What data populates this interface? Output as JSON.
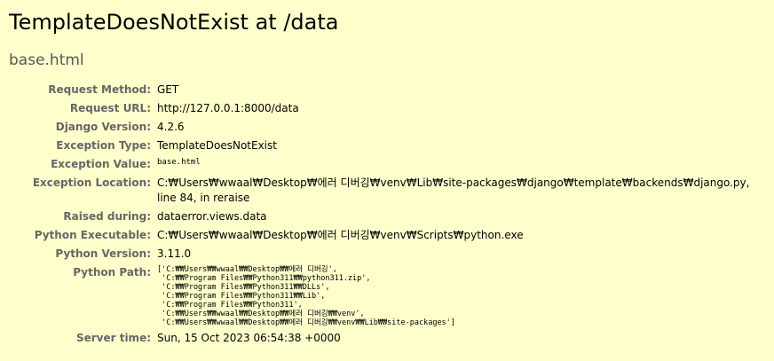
{
  "title": "TemplateDoesNotExist at /data",
  "subtitle": "base.html",
  "meta": {
    "request_method": {
      "label": "Request Method:",
      "value": "GET"
    },
    "request_url": {
      "label": "Request URL:",
      "value": "http://127.0.0.1:8000/data"
    },
    "django_version": {
      "label": "Django Version:",
      "value": "4.2.6"
    },
    "exception_type": {
      "label": "Exception Type:",
      "value": "TemplateDoesNotExist"
    },
    "exception_value": {
      "label": "Exception Value:",
      "value": "base.html"
    },
    "exception_location": {
      "label": "Exception Location:",
      "value": "C:₩Users₩wwaal₩Desktop₩에러 디버깅₩venv₩Lib₩site-packages₩django₩template₩backends₩django.py, line 84, in reraise"
    },
    "raised_during": {
      "label": "Raised during:",
      "value": "dataerror.views.data"
    },
    "python_executable": {
      "label": "Python Executable:",
      "value": "C:₩Users₩wwaal₩Desktop₩에러 디버깅₩venv₩Scripts₩python.exe"
    },
    "python_version": {
      "label": "Python Version:",
      "value": "3.11.0"
    },
    "python_path": {
      "label": "Python Path:",
      "value": "['C:₩₩Users₩₩wwaal₩₩Desktop₩₩에러 디버깅',\n 'C:₩₩Program Files₩₩Python311₩₩python311.zip',\n 'C:₩₩Program Files₩₩Python311₩₩DLLs',\n 'C:₩₩Program Files₩₩Python311₩₩Lib',\n 'C:₩₩Program Files₩₩Python311',\n 'C:₩₩Users₩₩wwaal₩₩Desktop₩₩에러 디버깅₩₩venv',\n 'C:₩₩Users₩₩wwaal₩₩Desktop₩₩에러 디버깅₩₩venv₩₩Lib₩₩site-packages']"
    },
    "server_time": {
      "label": "Server time:",
      "value": "Sun, 15 Oct 2023 06:54:38 +0000"
    }
  }
}
